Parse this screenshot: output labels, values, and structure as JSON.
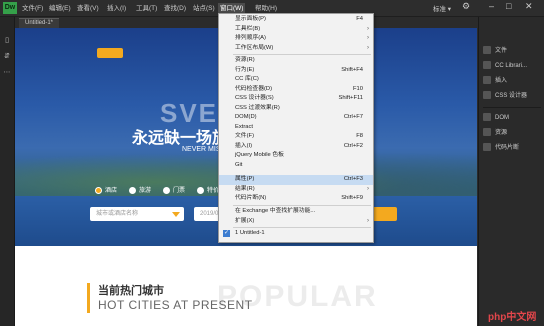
{
  "menubar": {
    "items": [
      "文件(F)",
      "编辑(E)",
      "查看(V)",
      "插入(I)",
      "工具(T)",
      "查找(D)",
      "站点(S)",
      "窗口(W)",
      "帮助(H)"
    ],
    "mode": "标准 ▾"
  },
  "tab": {
    "label": "Untitled-1*"
  },
  "window_menu": {
    "items": [
      {
        "label": "显示面板(P)",
        "shortcut": "F4"
      },
      {
        "label": "工具栏(B)",
        "submenu": true
      },
      {
        "label": "排列顺序(A)",
        "submenu": true
      },
      {
        "label": "工作区布局(W)",
        "submenu": true
      },
      {
        "label": "资源(R)",
        "shortcut": ""
      },
      {
        "label": "行为(E)",
        "shortcut": "Shift+F4"
      },
      {
        "label": "CC 库(C)",
        "shortcut": ""
      },
      {
        "label": "代码检查器(D)",
        "shortcut": "F10"
      },
      {
        "label": "CSS 设计器(S)",
        "shortcut": "Shift+F11"
      },
      {
        "label": "CSS 过渡效果(R)",
        "shortcut": ""
      },
      {
        "label": "DOM(D)",
        "shortcut": "Ctrl+F7"
      },
      {
        "label": "Extract",
        "shortcut": ""
      },
      {
        "label": "文件(F)",
        "shortcut": "F8"
      },
      {
        "label": "插入(I)",
        "shortcut": "Ctrl+F2"
      },
      {
        "label": "jQuery Mobile 色板",
        "shortcut": ""
      },
      {
        "label": "Git",
        "shortcut": ""
      },
      {
        "label": "属性(P)",
        "shortcut": "Ctrl+F3",
        "highlighted": true
      },
      {
        "label": "结果(R)",
        "submenu": true
      },
      {
        "label": "代码片断(N)",
        "shortcut": "Shift+F9"
      },
      {
        "label": "在 Exchange 中查找扩展功能...",
        "shortcut": ""
      },
      {
        "label": "扩展(X)",
        "submenu": true
      },
      {
        "label": "1 Untitled-1",
        "checked": true
      }
    ]
  },
  "panels": {
    "items": [
      "文件",
      "CC Librari...",
      "插入",
      "CSS 设计器",
      "DOM",
      "资源",
      "代码片断"
    ]
  },
  "page": {
    "hero_big": "SVEN",
    "hero_title": "永远缺一场旅行",
    "hero_sub": "NEVER MISS A TRIP",
    "radios": [
      "酒店",
      "旅游",
      "门票",
      "特价"
    ],
    "search_placeholder": "城市或酒店名称",
    "date_placeholder": "2019/01/15",
    "section_title_cn": "当前热门城市",
    "section_title_en": "HOT CITIES AT PRESENT",
    "section_bg": "POPULAR"
  },
  "watermark": "php中文网",
  "colors": {
    "accent": "#f3a91f",
    "highlight": "#c6dbf2",
    "ide_bg": "#2b2b2b"
  }
}
